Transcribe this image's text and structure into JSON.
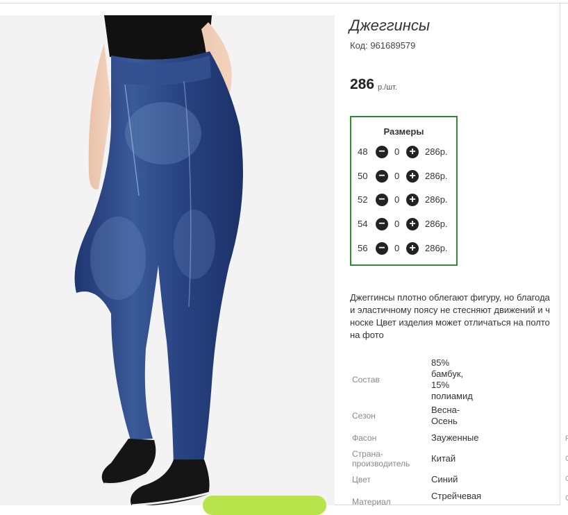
{
  "product": {
    "title": "Джеггинсы",
    "code": "Код: 961689579",
    "price": "286",
    "price_unit": "р./шт."
  },
  "sizes": {
    "title": "Размеры",
    "minus_icon": "minus-circle-icon",
    "plus_icon": "plus-circle-icon",
    "rows": [
      {
        "size": "48",
        "qty": "0",
        "price": "286р."
      },
      {
        "size": "50",
        "qty": "0",
        "price": "286р."
      },
      {
        "size": "52",
        "qty": "0",
        "price": "286р."
      },
      {
        "size": "54",
        "qty": "0",
        "price": "286р."
      },
      {
        "size": "56",
        "qty": "0",
        "price": "286р."
      }
    ]
  },
  "description": [
    "Джеггинсы плотно облегают фигуру, но благода",
    "и эластичному поясу не стесняют движений и ч",
    "носке Цвет изделия может отличаться на полто",
    "на фото"
  ],
  "attributes": [
    {
      "label": "Состав",
      "value": [
        "85%",
        "бамбук,",
        "15%",
        "полиамид"
      ]
    },
    {
      "label": "Сезон",
      "value": [
        "Весна-",
        "Осень"
      ]
    },
    {
      "label": "Фасон",
      "value": [
        "Зауженные"
      ]
    },
    {
      "label": [
        "Страна-",
        "производитель"
      ],
      "value": [
        "Китай"
      ]
    },
    {
      "label": "Цвет",
      "value": [
        "Синий"
      ]
    },
    {
      "label": "Материал",
      "value": [
        "Стрейчевая"
      ]
    }
  ],
  "edge_chars": [
    "F",
    "С",
    "С",
    "С"
  ],
  "colors": {
    "sizes_border": "#2e8b2e",
    "buy_button": "#b8e34a",
    "denim": "#2c4a86"
  }
}
